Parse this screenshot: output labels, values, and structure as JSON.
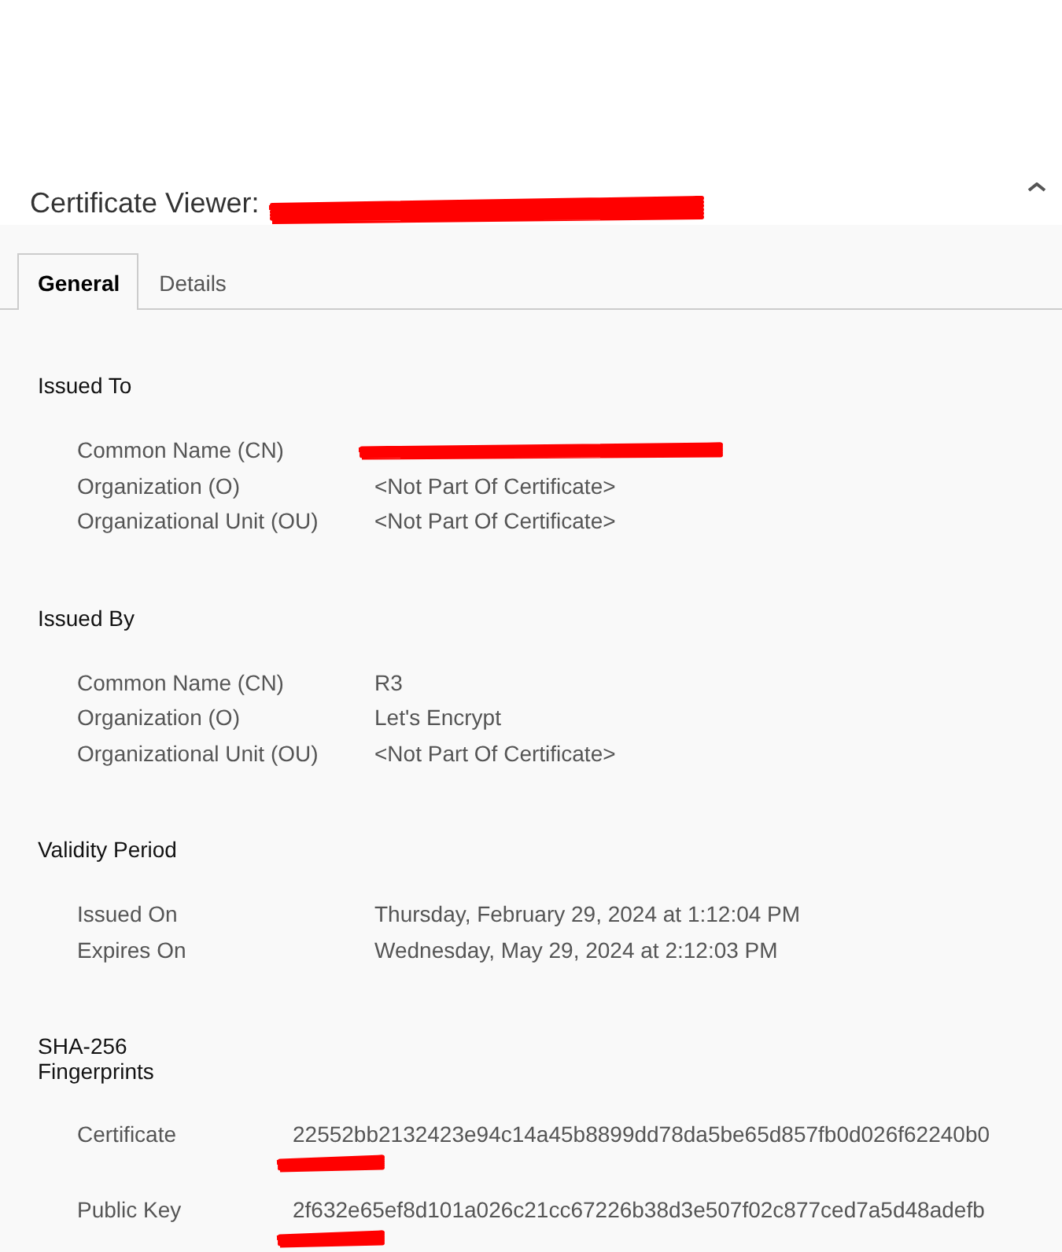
{
  "window": {
    "title": "Certificate Viewer:",
    "title_redacted": true
  },
  "tabs": [
    {
      "label": "General",
      "selected": true
    },
    {
      "label": "Details",
      "selected": false
    }
  ],
  "sections": [
    {
      "heading": "Issued To",
      "kind": "fields",
      "rows": [
        {
          "label": "Common Name (CN)",
          "redacted": true
        },
        {
          "label": "Organization (O)",
          "value": "<Not Part Of Certificate>",
          "redacted": false
        },
        {
          "label": "Organizational Unit (OU)",
          "value": "<Not Part Of Certificate>",
          "redacted": false
        }
      ]
    },
    {
      "heading": "Issued By",
      "kind": "fields",
      "rows": [
        {
          "label": "Common Name (CN)",
          "value": "R3",
          "redacted": false
        },
        {
          "label": "Organization (O)",
          "value": "Let's Encrypt",
          "redacted": false
        },
        {
          "label": "Organizational Unit (OU)",
          "value": "<Not Part Of Certificate>",
          "redacted": false
        }
      ]
    },
    {
      "heading": "Validity Period",
      "kind": "fields",
      "rows": [
        {
          "label": "Issued On",
          "value": "Thursday, February 29, 2024 at 1:12:04 PM",
          "redacted": false
        },
        {
          "label": "Expires On",
          "value": "Wednesday, May 29, 2024 at 2:12:03 PM",
          "redacted": false
        }
      ]
    },
    {
      "heading": "SHA-256\nFingerprints",
      "kind": "fingerprints",
      "rows": [
        {
          "label": "Certificate",
          "value": "22552bb2132423e94c14a45b8899dd78da5be65d857fb0d026f62240b0",
          "redacted": true
        },
        {
          "label": "Public Key",
          "value": "2f632e65ef8d101a026c21cc67226b38d3e507f02c877ced7a5d48adefb",
          "redacted": true
        }
      ]
    }
  ]
}
